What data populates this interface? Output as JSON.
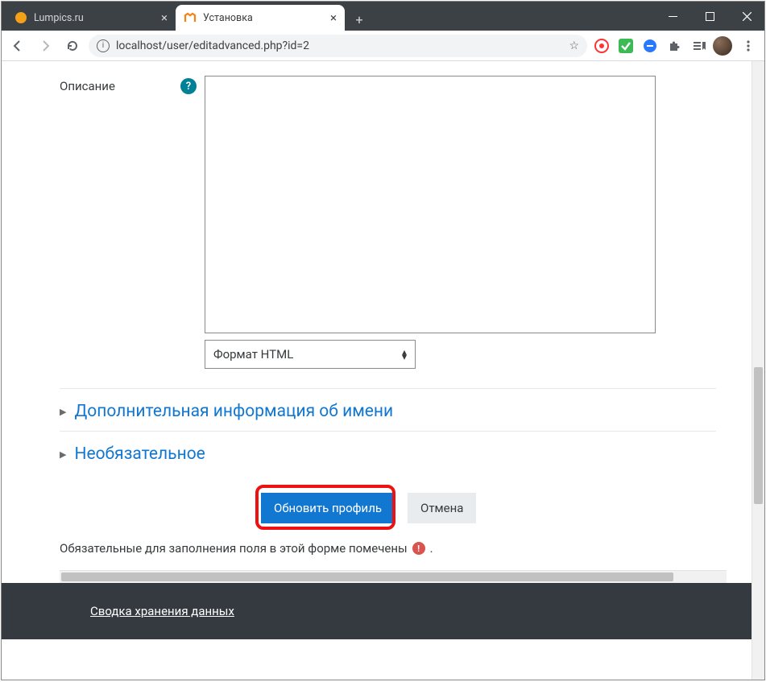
{
  "window": {
    "tabs": [
      {
        "title": "Lumpics.ru",
        "active": false
      },
      {
        "title": "Установка",
        "active": true
      }
    ],
    "url": "localhost/user/editadvanced.php?id=2"
  },
  "form": {
    "description_label": "Описание",
    "format_selected": "Формат HTML",
    "sections": {
      "additional_name_info": "Дополнительная информация об имени",
      "optional": "Необязательное"
    },
    "actions": {
      "update_profile": "Обновить профиль",
      "cancel": "Отмена"
    },
    "required_note": "Обязательные для заполнения поля в этой форме помечены",
    "required_note_tail": "."
  },
  "footer": {
    "data_retention_link": "Сводка хранения данных"
  }
}
